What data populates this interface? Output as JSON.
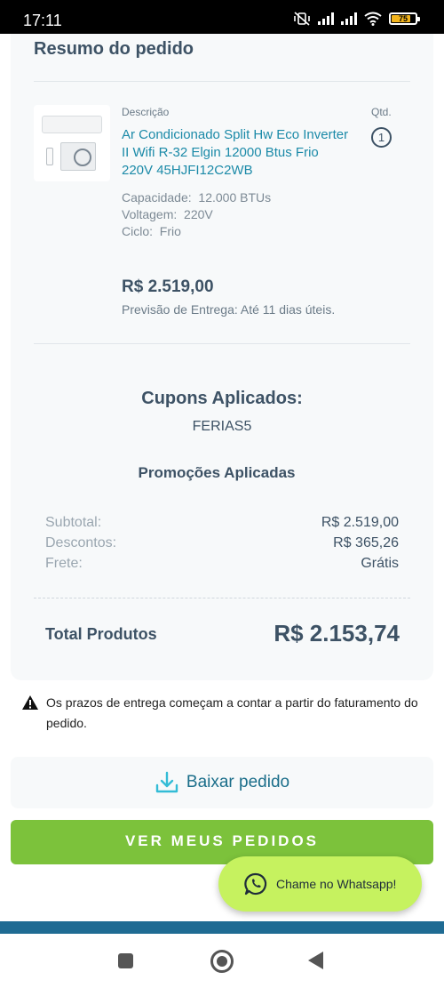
{
  "status_bar": {
    "time": "17:11",
    "battery": "75",
    "icons": [
      "mute-vibrate-icon",
      "signal-icon",
      "signal-icon",
      "wifi-icon",
      "battery-icon"
    ]
  },
  "summary": {
    "title": "Resumo do pedido",
    "description_label": "Descrição",
    "qty_label": "Qtd.",
    "qty_value": "1",
    "product_name": "Ar Condicionado Split Hw Eco Inverter II Wifi R-32 Elgin 12000 Btus Frio 220V 45HJFI12C2WB",
    "specs": [
      {
        "label": "Capacidade:",
        "value": "12.000 BTUs"
      },
      {
        "label": "Voltagem:",
        "value": "220V"
      },
      {
        "label": "Ciclo:",
        "value": "Frio"
      }
    ],
    "price": "R$ 2.519,00",
    "delivery": "Previsão de Entrega: Até 11 dias úteis."
  },
  "coupons": {
    "title": "Cupons Aplicados:",
    "code": "FERIAS5",
    "promotions_title": "Promoções Aplicadas"
  },
  "totals": {
    "subtotal_label": "Subtotal:",
    "subtotal_value": "R$ 2.519,00",
    "discounts_label": "Descontos:",
    "discounts_value": "R$ 365,26",
    "shipping_label": "Frete:",
    "shipping_value": "Grátis",
    "total_label": "Total Produtos",
    "total_value": "R$ 2.153,74"
  },
  "notice": "Os prazos de entrega começam a contar a partir do faturamento do pedido.",
  "actions": {
    "download_label": "Baixar pedido",
    "orders_label": "VER MEUS PEDIDOS",
    "whatsapp_label": "Chame no Whatsapp!"
  },
  "colors": {
    "accent_green": "#7cc23b",
    "whatsapp_green": "#c6f25f",
    "link_blue": "#1b8aa8",
    "brand_blue": "#1f6b93"
  }
}
